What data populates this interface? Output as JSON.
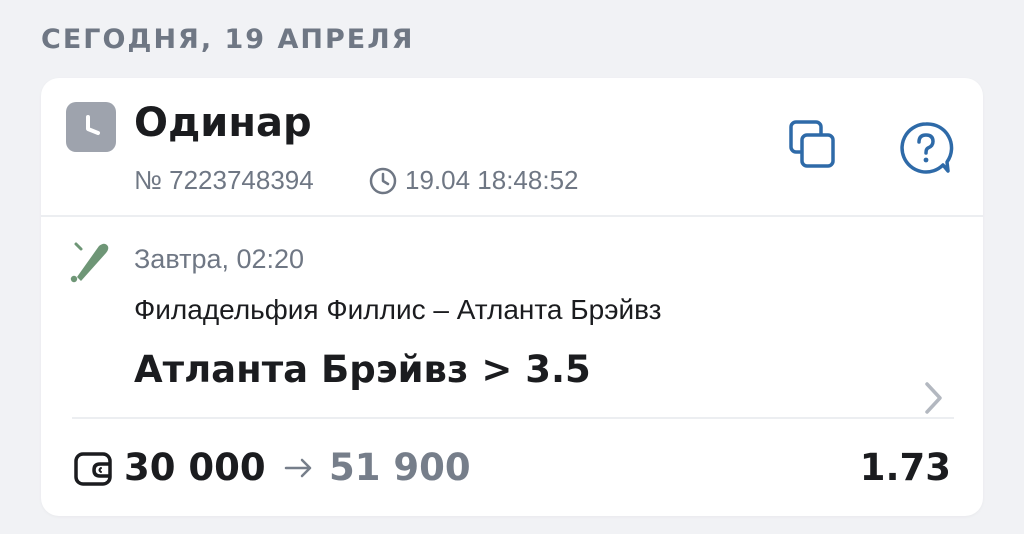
{
  "date_header": "СЕГОДНЯ, 19 АПРЕЛЯ",
  "bet": {
    "type": "Одинар",
    "number": "№ 7223748394",
    "time": "19.04 18:48:52",
    "status_icon": "clock-icon"
  },
  "actions": {
    "copy_icon": "copy-icon",
    "help_icon": "help-bubble-icon"
  },
  "event": {
    "sport_icon": "baseball-bat-icon",
    "date": "Завтра, 02:20",
    "name": "Филадельфия Филлис – Атланта Брэйвз",
    "selection": "Атланта Брэйвз > 3.5"
  },
  "summary": {
    "stake": "30 000",
    "payout": "51 900",
    "odds": "1.73"
  },
  "colors": {
    "accent": "#2e6aa8",
    "muted": "#6f7784",
    "sport_icon": "#6e9676",
    "status_icon_bg": "#9ea3ad",
    "background": "#f1f2f5"
  }
}
